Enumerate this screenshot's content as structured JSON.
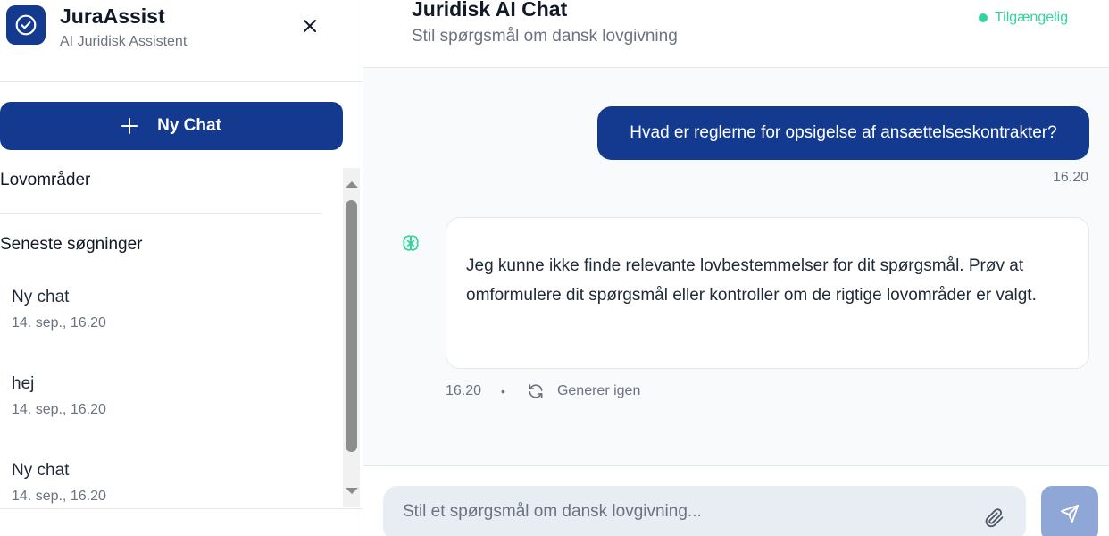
{
  "brand": {
    "title": "JuraAssist",
    "subtitle": "AI Juridisk Assistent"
  },
  "sidebar": {
    "new_chat_label": "Ny Chat",
    "sections": {
      "law_areas": "Lovområder",
      "recent": "Seneste søgninger"
    },
    "recent_chats": [
      {
        "title": "Ny chat",
        "date": "14. sep., 16.20"
      },
      {
        "title": "hej",
        "date": "14. sep., 16.20"
      },
      {
        "title": "Ny chat",
        "date": "14. sep., 16.20"
      }
    ]
  },
  "header": {
    "title": "Juridisk AI Chat",
    "subtitle": "Stil spørgsmål om dansk lovgivning",
    "status": "Tilgængelig"
  },
  "messages": {
    "user": {
      "text": "Hvad er reglerne for opsigelse af ansættelseskontrakter?",
      "time": "16.20"
    },
    "assistant": {
      "text": "Jeg kunne ikke finde relevante lovbestemmelser for dit spørgsmål. Prøv at omformulere dit spørgsmål eller kontroller om de rigtige lovområder er valgt.",
      "time": "16.20",
      "separator": "•",
      "regenerate_label": "Generer igen"
    }
  },
  "composer": {
    "placeholder": "Stil et spørgsmål om dansk lovgivning..."
  },
  "icons": {
    "brand": "check-circle-icon",
    "close": "close-icon",
    "new_chat": "plus-icon",
    "assistant": "brain-icon",
    "regenerate": "refresh-icon",
    "attach": "paperclip-icon",
    "send": "send-icon"
  },
  "colors": {
    "primary": "#143a8f",
    "status": "#34d399",
    "send_disabled": "#8ea7d6"
  }
}
